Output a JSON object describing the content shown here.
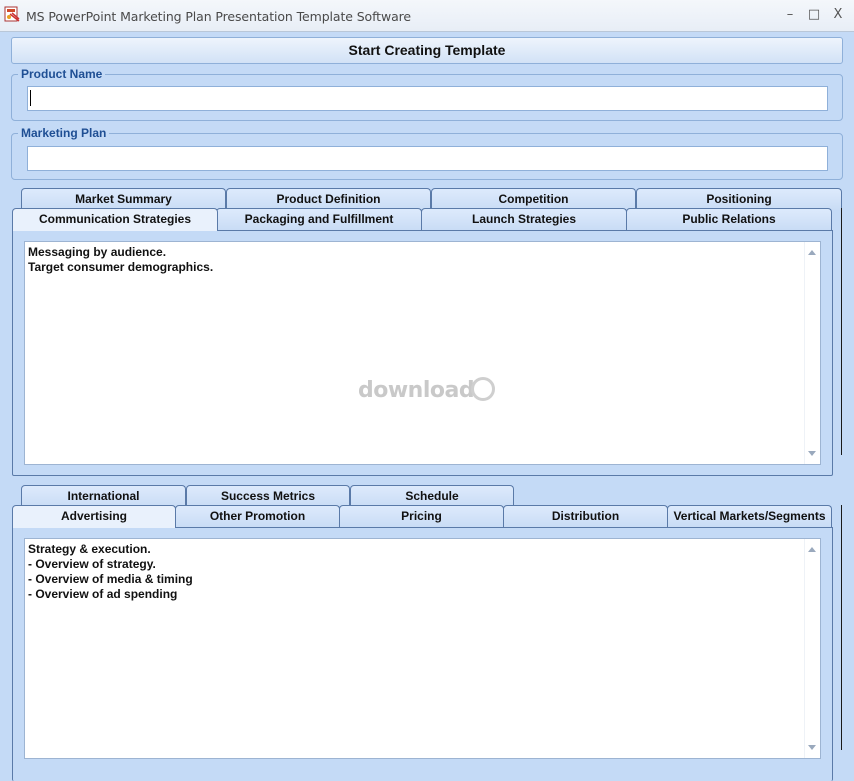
{
  "window": {
    "title": "MS PowerPoint Marketing Plan Presentation Template Software",
    "controls": {
      "minimize": "–",
      "maximize": "□",
      "close": "X"
    }
  },
  "start_button": "Start Creating Template",
  "product_name": {
    "label": "Product Name",
    "value": "",
    "placeholder": ""
  },
  "marketing_plan": {
    "label": "Marketing Plan",
    "value": "",
    "placeholder": ""
  },
  "tabs_top": {
    "row_back": [
      "Market Summary",
      "Product Definition",
      "Competition",
      "Positioning"
    ],
    "row_front": [
      "Communication Strategies",
      "Packaging and Fulfillment",
      "Launch  Strategies",
      "Public Relations"
    ],
    "active": "Communication Strategies",
    "content": [
      "Messaging by audience.",
      "Target consumer demographics."
    ]
  },
  "tabs_bottom": {
    "row_back": [
      "International",
      "Success Metrics",
      "Schedule"
    ],
    "row_front": [
      "Advertising",
      "Other Promotion",
      "Pricing",
      "Distribution",
      "Vertical Markets/Segments"
    ],
    "active": "Advertising",
    "content": [
      "Strategy & execution.",
      "- Overview of strategy.",
      "- Overview of media & timing",
      "- Overview of ad spending"
    ]
  },
  "watermark": "download",
  "icons": {
    "app": "app-icon",
    "scroll_up": "scroll-up-arrow-icon",
    "scroll_down": "scroll-down-arrow-icon"
  }
}
